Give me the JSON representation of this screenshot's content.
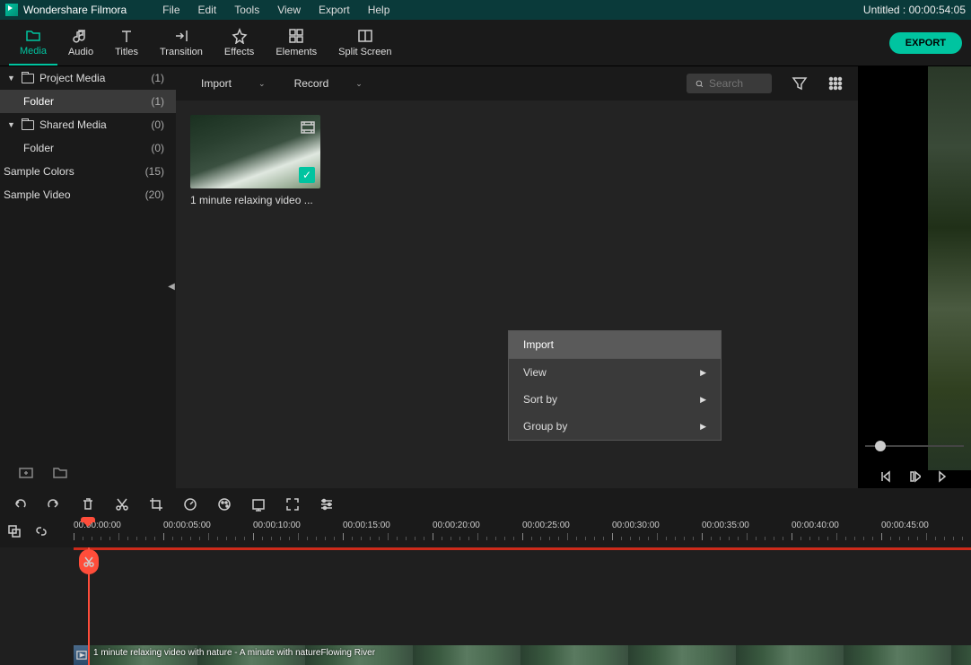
{
  "app_title": "Wondershare Filmora",
  "menu": [
    "File",
    "Edit",
    "Tools",
    "View",
    "Export",
    "Help"
  ],
  "project_title": "Untitled : 00:00:54:05",
  "tabs": [
    {
      "label": "Media",
      "active": true
    },
    {
      "label": "Audio"
    },
    {
      "label": "Titles"
    },
    {
      "label": "Transition"
    },
    {
      "label": "Effects"
    },
    {
      "label": "Elements"
    },
    {
      "label": "Split Screen"
    }
  ],
  "export_label": "EXPORT",
  "sidebar": {
    "items": [
      {
        "label": "Project Media",
        "count": "(1)",
        "expandable": true,
        "folder": true
      },
      {
        "label": "Folder",
        "count": "(1)",
        "selected": true,
        "indent": true
      },
      {
        "label": "Shared Media",
        "count": "(0)",
        "expandable": true,
        "folder": true
      },
      {
        "label": "Folder",
        "count": "(0)",
        "indent": true
      },
      {
        "label": "Sample Colors",
        "count": "(15)",
        "simple": true
      },
      {
        "label": "Sample Video",
        "count": "(20)",
        "simple": true
      }
    ]
  },
  "content_toolbar": {
    "import": "Import",
    "record": "Record",
    "search_placeholder": "Search"
  },
  "media_item": {
    "label": "1 minute relaxing video ..."
  },
  "context_menu": {
    "items": [
      {
        "label": "Import",
        "highlight": true
      },
      {
        "label": "View",
        "arrow": true
      },
      {
        "label": "Sort by",
        "arrow": true
      },
      {
        "label": "Group by",
        "arrow": true
      }
    ]
  },
  "ruler_ticks": [
    "00:00:00:00",
    "00:00:05:00",
    "00:00:10:00",
    "00:00:15:00",
    "00:00:20:00",
    "00:00:25:00",
    "00:00:30:00",
    "00:00:35:00",
    "00:00:40:00",
    "00:00:45:00"
  ],
  "clip_label": "1 minute relaxing video with nature - A minute with natureFlowing River"
}
